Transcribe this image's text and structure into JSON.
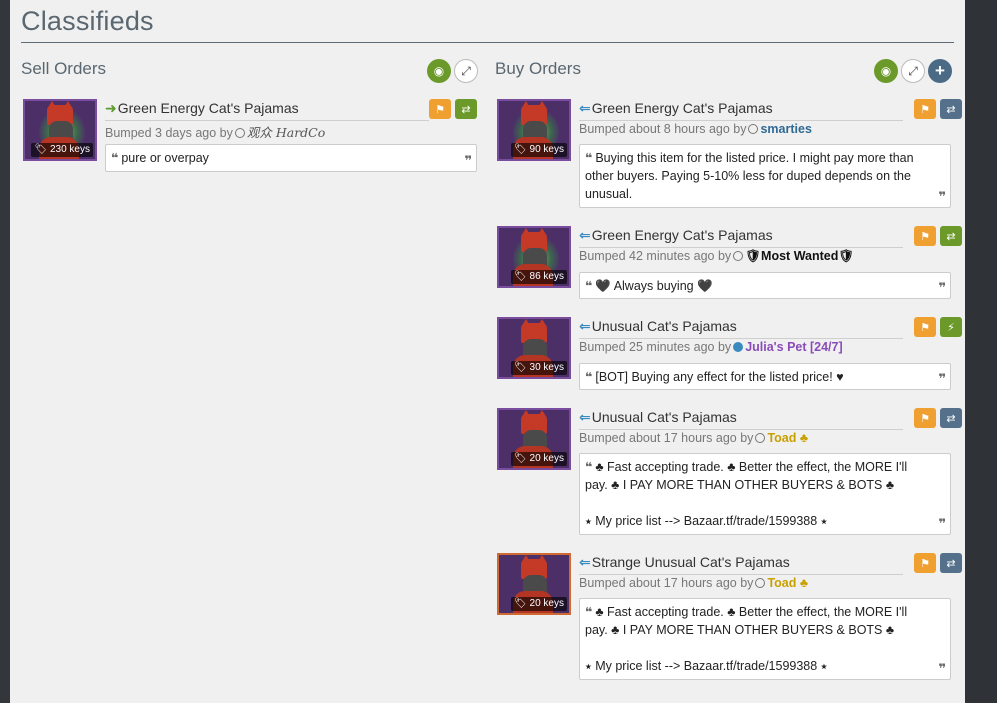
{
  "page_title": "Classifieds",
  "sell": {
    "heading": "Sell Orders",
    "listings": [
      {
        "title": "Green Energy Cat's Pajamas",
        "price": "230 keys",
        "bump": "Bumped 3 days ago by",
        "user": "观众 HardCo",
        "message": "pure or overpay"
      }
    ]
  },
  "buy": {
    "heading": "Buy Orders",
    "listings": [
      {
        "title": "Green Energy Cat's Pajamas",
        "price": "90 keys",
        "bump": "Bumped about 8 hours ago by",
        "user": "smarties",
        "message": "Buying this item for the listed price. I might pay more than other buyers. Paying 5-10% less for duped depends on the unusual."
      },
      {
        "title": "Green Energy Cat's Pajamas",
        "price": "86 keys",
        "bump": "Bumped 42 minutes ago by",
        "user": "🛡Most Wanted🛡",
        "message": "🖤 Always buying 🖤"
      },
      {
        "title": "Unusual Cat's Pajamas",
        "price": "30 keys",
        "bump": "Bumped 25 minutes ago by",
        "user": "Julia's Pet [24/7]",
        "message": "[BOT] Buying any effect for the listed price! ♥"
      },
      {
        "title": "Unusual Cat's Pajamas",
        "price": "20 keys",
        "bump": "Bumped about 17 hours ago by",
        "user": "Toad",
        "user_badge": "♣",
        "message": "♣ Fast accepting trade. ♣ Better the effect, the MORE I'll pay. ♣ I PAY MORE THAN OTHER BUYERS & BOTS ♣\n\n  ⭑   My price list --> Bazaar.tf/trade/1599388   ⭑"
      },
      {
        "title": "Strange Unusual Cat's Pajamas",
        "price": "20 keys",
        "bump": "Bumped about 17 hours ago by",
        "user": "Toad",
        "user_badge": "♣",
        "message": "♣ Fast accepting trade. ♣ Better the effect, the MORE I'll pay. ♣ I PAY MORE THAN OTHER BUYERS & BOTS ♣\n\n  ⭑   My price list --> Bazaar.tf/trade/1599388   ⭑"
      }
    ]
  },
  "icons": {
    "tag": "🏷",
    "flag": "⚑",
    "swap": "⇄",
    "bolt": "⚡",
    "eye": "◉",
    "expand": "⤢",
    "plus": "+",
    "quote_open": "❝",
    "quote_close": "❞",
    "arrow_sell": "➜",
    "arrow_buy": "⇐"
  },
  "colors": {
    "unusual_border": "#7a4c9e",
    "strange_border": "#cf6a32",
    "flag_orange": "#f0a030",
    "trade_green": "#6b9a2a",
    "trade_slate": "#55708a"
  }
}
